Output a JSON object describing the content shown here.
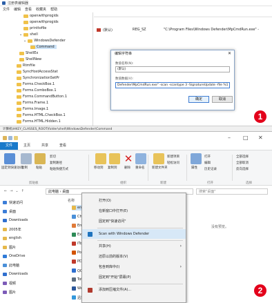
{
  "registry": {
    "title": "注册表编辑器",
    "menu": [
      "文件",
      "编辑",
      "查看",
      "收藏夹",
      "帮助"
    ],
    "tree": [
      "openwithprogids",
      "openwithprogids",
      "printtofile",
      "shell",
      "WindowsDefender",
      "Command",
      "ShellEx",
      "ShellNew",
      "Rtmfile",
      "SyncHostAccessStat",
      "SynchronizationSetPr",
      "Forms.CheckBox.1",
      "Forms.ComboBox.1",
      "Forms.CommandButton.1",
      "Forms.Frame.1",
      "Forms.Image.1",
      "Forms.HTML.CheckBox.1",
      "Forms.HTML.Hidden.1"
    ],
    "value_row": {
      "name": "(默认)",
      "type": "REG_SZ",
      "data": "\"C:\\Program Files\\Windows Defender\\MpCmdRun.exe\" -"
    },
    "status": "计算机\\HKEY_CLASSES_ROOT\\folder\\shell\\WindowsDefender\\Command",
    "dialog": {
      "title": "编辑字符串",
      "name_label": "数值名称(N):",
      "name_value": "(默认)",
      "data_label": "数值数据(V):",
      "data_value": "Defender\\MpCmdRun.exe\" -scan -scantype 3 -SignatureUpdate -file %1",
      "ok": "确定",
      "cancel": "取消"
    },
    "badge": "1"
  },
  "explorer": {
    "window_controls": [
      "–",
      "□",
      "✕"
    ],
    "tabs": [
      "文件",
      "主页",
      "共享",
      "查看"
    ],
    "ribbon": {
      "groups": [
        "剪贴板",
        "组织",
        "新建",
        "打开",
        "选择"
      ],
      "buttons": [
        "固定到快速访问",
        "复制",
        "粘贴",
        "移动到",
        "复制到",
        "删除",
        "重命名",
        "新建文件夹",
        "属性",
        "全部选择"
      ],
      "small": [
        "剪切",
        "复制路径",
        "粘贴快捷方式",
        "新建项目",
        "轻松访问",
        "打开",
        "编辑",
        "历史记录",
        "全部取消",
        "反向选择"
      ]
    },
    "address": "此电脑 › 桌面",
    "search_placeholder": "搜索\"桌面\"",
    "nav": [
      {
        "label": "快速访问",
        "color": "#3b7dd8"
      },
      {
        "label": "桌面",
        "color": "#3b7dd8"
      },
      {
        "label": "Downloads",
        "color": "#2f6fcf"
      },
      {
        "label": "2005年",
        "color": "#e6b84a"
      },
      {
        "label": "english",
        "color": "#e6b84a"
      },
      {
        "label": "图片",
        "color": "#e6b84a"
      },
      {
        "label": "OneDrive",
        "color": "#2f7bd8"
      },
      {
        "label": "此电脑",
        "color": "#4a90d9"
      },
      {
        "label": "Downloads",
        "color": "#2f6fcf"
      },
      {
        "label": "视频",
        "color": "#7c5bb8"
      },
      {
        "label": "图片",
        "color": "#7c5bb8"
      }
    ],
    "files_header": "名称",
    "files": [
      "englis",
      "Chron",
      "EmEd",
      "Excel",
      "iTool",
      "Power",
      "PDFet",
      "QQ影",
      "Total",
      "Word",
      "迅雷"
    ],
    "empty_note": "没有预览。",
    "context_menu": [
      {
        "label": "打开(O)",
        "sep_after": false,
        "submenu": false
      },
      {
        "label": "在新窗口中打开(E)",
        "sep_after": false,
        "submenu": false
      },
      {
        "label": "固定到\"快速访问\"",
        "sep_after": true,
        "submenu": false
      },
      {
        "label": "Scan with Windows Defender",
        "sep_after": true,
        "submenu": false,
        "highlight": true
      },
      {
        "label": "共享(H)",
        "sep_after": false,
        "submenu": true
      },
      {
        "label": "还原以前的版本(V)",
        "sep_after": false,
        "submenu": false
      },
      {
        "label": "包含到库中(I)",
        "sep_after": false,
        "submenu": true
      },
      {
        "label": "固定到\"开始\"屏幕(P)",
        "sep_after": true,
        "submenu": false
      },
      {
        "label": "添加到压缩文件(A)...",
        "sep_after": false,
        "submenu": false
      }
    ],
    "badge": "2"
  }
}
